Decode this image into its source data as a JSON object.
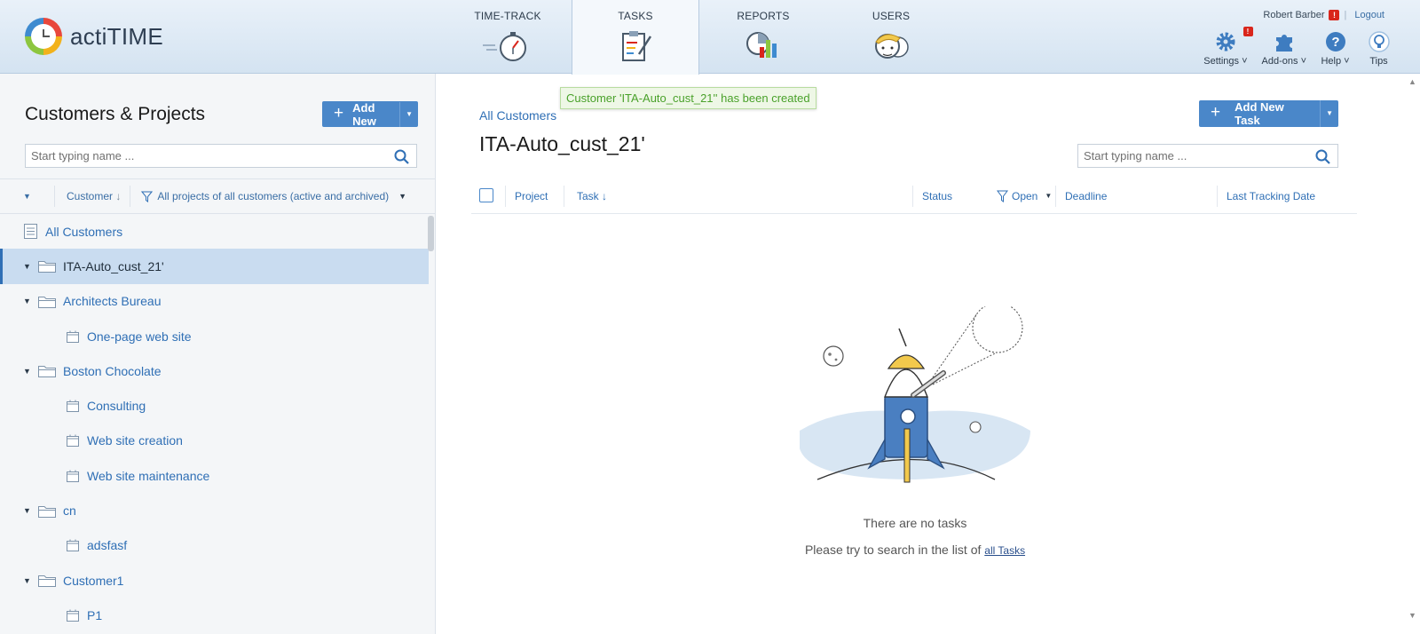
{
  "app": {
    "logo_text": "actiTIME"
  },
  "nav": {
    "items": [
      {
        "label": "TIME-TRACK",
        "icon": "stopwatch-icon"
      },
      {
        "label": "TASKS",
        "icon": "clipboard-icon",
        "active": true
      },
      {
        "label": "REPORTS",
        "icon": "chart-icon"
      },
      {
        "label": "USERS",
        "icon": "users-icon"
      }
    ]
  },
  "user": {
    "name": "Robert Barber",
    "alert": "!",
    "logout": "Logout",
    "separator": "|"
  },
  "tools": {
    "settings": {
      "label": "Settings",
      "badge": "!"
    },
    "addons": {
      "label": "Add-ons"
    },
    "help": {
      "label": "Help"
    },
    "tips": {
      "label": "Tips"
    },
    "caret": "˅"
  },
  "left": {
    "title": "Customers & Projects",
    "add_button": "Add New",
    "search_placeholder": "Start typing name ...",
    "filter": {
      "sort_label": "Customer",
      "sort_arrow": "↓",
      "filter_label": "All projects of all customers (active and archived)"
    },
    "tree": [
      {
        "label": "All Customers",
        "level": 0,
        "type": "list"
      },
      {
        "label": "ITA-Auto_cust_21'",
        "level": 1,
        "type": "customer",
        "selected": true
      },
      {
        "label": "Architects Bureau",
        "level": 1,
        "type": "customer"
      },
      {
        "label": "One-page web site",
        "level": 2,
        "type": "project"
      },
      {
        "label": "Boston Chocolate",
        "level": 1,
        "type": "customer"
      },
      {
        "label": "Consulting",
        "level": 2,
        "type": "project"
      },
      {
        "label": "Web site creation",
        "level": 2,
        "type": "project"
      },
      {
        "label": "Web site maintenance",
        "level": 2,
        "type": "project"
      },
      {
        "label": "cn",
        "level": 1,
        "type": "customer"
      },
      {
        "label": "adsfasf",
        "level": 2,
        "type": "project"
      },
      {
        "label": "Customer1",
        "level": 1,
        "type": "customer"
      },
      {
        "label": "P1",
        "level": 2,
        "type": "project"
      }
    ]
  },
  "main": {
    "toast": "Customer 'ITA-Auto_cust_21'' has been created",
    "breadcrumb": "All Customers",
    "title": "ITA-Auto_cust_21'",
    "add_task_button": "Add New Task",
    "search_placeholder": "Start typing name ...",
    "columns": {
      "project": "Project",
      "task": "Task",
      "task_arrow": "↓",
      "status": "Status",
      "status_filter": "Open",
      "deadline": "Deadline",
      "last_tracking": "Last Tracking Date"
    },
    "empty": {
      "title": "There are no tasks",
      "hint_prefix": "Please try to search in the list of ",
      "hint_link": "all Tasks"
    }
  },
  "colors": {
    "accent": "#4a87c9",
    "link": "#2f6fb5",
    "selected_row": "#c9dcf0",
    "toast_text": "#49a12a",
    "alert": "#d9261c"
  }
}
